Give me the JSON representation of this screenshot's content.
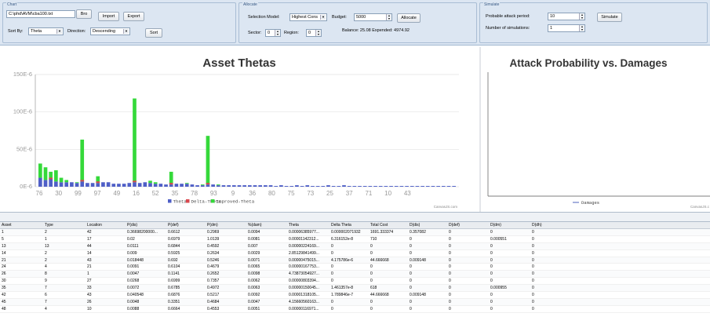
{
  "chart_group": {
    "title": "Chart",
    "file_path": "C:\\phd\\AVM\\cba100.txt",
    "browse_label": "Bro",
    "import_label": "Import",
    "export_label": "Export",
    "sort_by_label": "Sort By:",
    "sort_by_value": "Theta",
    "direction_label": "Direction:",
    "direction_value": "Descending",
    "sort_label": "Sort"
  },
  "allocate_group": {
    "title": "Allocate",
    "selection_model_label": "Selection Model:",
    "selection_model_value": "Highest Cons",
    "budget_label": "Budget:",
    "budget_value": "5000",
    "allocate_label": "Allocate",
    "sector_label": "Sector:",
    "sector_value": "0",
    "region_label": "Region:",
    "region_value": "0",
    "balance_text": "Balance:  25.08  Expended:  4974.92"
  },
  "simulate_group": {
    "title": "Simulate",
    "attack_period_label": "Probable attack period:",
    "attack_period_value": "10",
    "num_sims_label": "Number of simulations:",
    "num_sims_value": "1",
    "simulate_label": "Simulate"
  },
  "chart_data": [
    {
      "type": "bar",
      "title": "Asset Thetas",
      "ylim": [
        0,
        0.00015
      ],
      "y_ticks": [
        "0E-6",
        "50E-6",
        "100E-6",
        "150E-6"
      ],
      "x_tick_labels": [
        "76",
        "30",
        "99",
        "97",
        "49",
        "16",
        "52",
        "35",
        "78",
        "93",
        "9",
        "36",
        "80",
        "75",
        "73",
        "25",
        "37",
        "71",
        "10",
        "43"
      ],
      "series": [
        {
          "name": "Theta",
          "color": "#4f5fc7"
        },
        {
          "name": "Delta-Theta",
          "color": "#d9484f"
        },
        {
          "name": "Improved-Theta",
          "color": "#35d93a"
        }
      ],
      "improved_theta_values": [
        31,
        26,
        20,
        22,
        12,
        9,
        6,
        6,
        63,
        5,
        5,
        14,
        6,
        4,
        4,
        3,
        4,
        5,
        118,
        5,
        4,
        8,
        6,
        3,
        3,
        20,
        4,
        4,
        5,
        2,
        2,
        3,
        68,
        3,
        3,
        2,
        2,
        2,
        2,
        2
      ],
      "theta_values": [
        12,
        9,
        10,
        7,
        6,
        6,
        6,
        5,
        7,
        5,
        5,
        5,
        6,
        6,
        4,
        4,
        4,
        5,
        6,
        5,
        6,
        5,
        4,
        4,
        3,
        3,
        4,
        4,
        4,
        3,
        2,
        2,
        3,
        3,
        2,
        2,
        2,
        2,
        2,
        2,
        2,
        2,
        2,
        2,
        2,
        1,
        2,
        1,
        1,
        2,
        1,
        2,
        1,
        1,
        1,
        2,
        1,
        1,
        2,
        1,
        1,
        1,
        1,
        1,
        1,
        1,
        1,
        1,
        1,
        1,
        1,
        1,
        1,
        1,
        1,
        1,
        1,
        1,
        1,
        1
      ],
      "credit": "CanvasJS.com"
    },
    {
      "type": "line",
      "title": "Attack Probability vs. Damages",
      "series": [
        {
          "name": "Damages",
          "color": "#6a7bc9"
        }
      ],
      "credit": "CanvasJS.c"
    }
  ],
  "table": {
    "columns": [
      "Asset",
      "Type",
      "Location",
      "P(dis)",
      "P(def)",
      "P(dm)",
      "%(dam)",
      "Theta",
      "Delta Theta",
      "Total Cost",
      "D(dis)",
      "D(def)",
      "D(dm)",
      "D(dh)"
    ],
    "rows": [
      [
        "1",
        "2",
        "42",
        "0.36698200000...",
        "0.6612",
        "0.2969",
        "0.0094",
        "0.00006385977...",
        "0.000002071932",
        "1691.333374",
        "0.357082",
        "0",
        "0",
        "0"
      ],
      [
        "5",
        "1",
        "17",
        "0.02",
        "0.6979",
        "1.0139",
        "0.0081",
        "0.00001142312...",
        "6.316152e-8",
        "710",
        "0",
        "0",
        "0.000551",
        "0"
      ],
      [
        "13",
        "13",
        "44",
        "0.0111",
        "0.6844",
        "0.4592",
        "0.007",
        "0.00000224169...",
        "0",
        "0",
        "0",
        "0",
        "0",
        "0"
      ],
      [
        "14",
        "2",
        "14",
        "0.009",
        "0.5925",
        "0.2634",
        "0.0029",
        "2.85129841499...",
        "0",
        "0",
        "0",
        "0",
        "0",
        "0"
      ],
      [
        "21",
        "2",
        "43",
        "0.018448",
        "0.692",
        "0.5246",
        "0.0071",
        "0.00000475015...",
        "4.175786e-6",
        "44.666668",
        "0.009148",
        "0",
        "0",
        "0"
      ],
      [
        "24",
        "4",
        "21",
        "0.0091",
        "0.6104",
        "0.4679",
        "0.0065",
        "0.00000167753...",
        "0",
        "0",
        "0",
        "0",
        "0",
        "0"
      ],
      [
        "26",
        "8",
        "1",
        "0.0047",
        "0.1141",
        "0.2652",
        "0.0098",
        "4.73873054927...",
        "0",
        "0",
        "0",
        "0",
        "0",
        "0"
      ],
      [
        "30",
        "9",
        "27",
        "0.0268",
        "0.6999",
        "0.7357",
        "0.0062",
        "0.00000803394...",
        "0",
        "0",
        "0",
        "0",
        "0",
        "0"
      ],
      [
        "35",
        "7",
        "33",
        "0.0072",
        "0.6785",
        "0.4972",
        "0.0063",
        "0.00000150045...",
        "1.461357e-8",
        "618",
        "0",
        "0",
        "0.000955",
        "0"
      ],
      [
        "42",
        "6",
        "43",
        "0.040548",
        "0.6876",
        "0.5217",
        "0.0092",
        "0.00001318105...",
        "1.789846e-7",
        "44.666668",
        "0.009148",
        "0",
        "0",
        "0"
      ],
      [
        "45",
        "7",
        "26",
        "0.0048",
        "0.3351",
        "0.4684",
        "0.0047",
        "4.15660560163...",
        "0",
        "0",
        "0",
        "0",
        "0",
        "0"
      ],
      [
        "48",
        "4",
        "10",
        "0.0088",
        "0.6664",
        "0.4553",
        "0.0051",
        "0.00000116971...",
        "0",
        "0",
        "0",
        "0",
        "0",
        "0"
      ]
    ]
  }
}
